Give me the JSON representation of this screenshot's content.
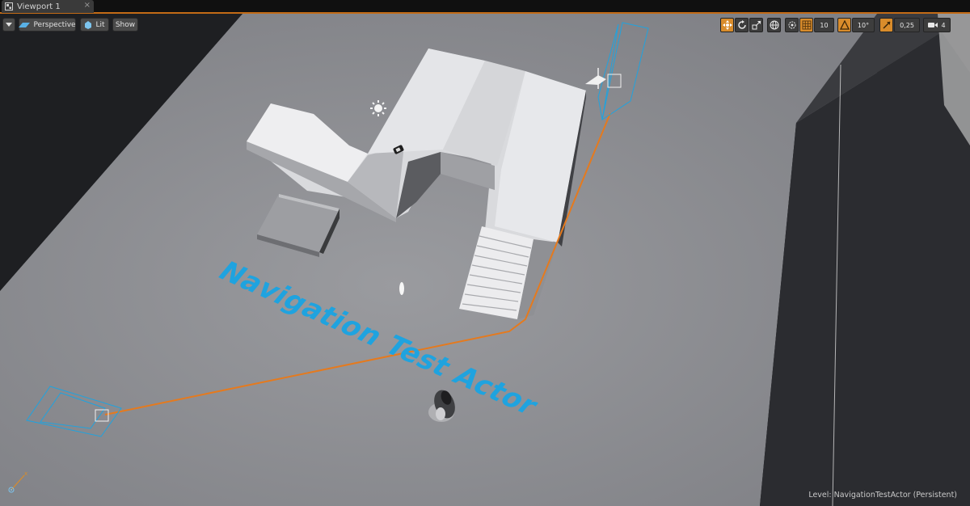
{
  "tab": {
    "title": "Viewport 1",
    "close": "×"
  },
  "toolbar": {
    "perspective_label": "Perspective",
    "lit_label": "Lit",
    "show_label": "Show",
    "grid_snap_value": "10",
    "rotation_snap_value": "10°",
    "scale_snap_value": "0,25",
    "camera_speed_value": "4"
  },
  "scene": {
    "label_text": "Navigation Test Actor"
  },
  "status": {
    "level_prefix": "Level:",
    "level_name": "NavigationTestActor (Persistent)"
  },
  "colors": {
    "path": "#e57a1e",
    "selection": "#1fa3df",
    "accent": "#d98c2b"
  },
  "icons": [
    "viewport-tab-icon",
    "dropdown-arrow-icon",
    "perspective-icon",
    "lit-icon",
    "translate-icon",
    "rotate-icon",
    "scale-icon",
    "world-local-icon",
    "surface-snap-icon",
    "grid-snap-icon",
    "rotation-snap-icon",
    "scale-snap-icon",
    "camera-speed-icon",
    "axis-indicator-icon"
  ]
}
